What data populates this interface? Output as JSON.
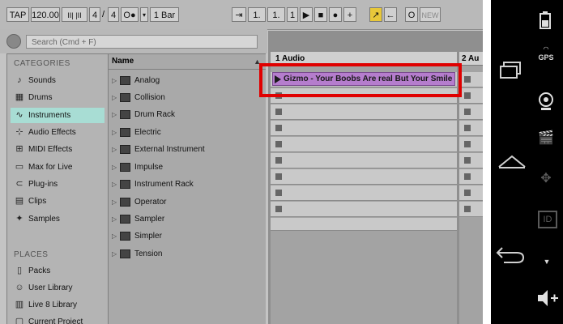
{
  "toolbar": {
    "tap": "TAP",
    "tempo": "120.00",
    "signature_num": "4",
    "signature_den": "4",
    "metro": "O●",
    "quantize": "1 Bar",
    "position_bar": "1.",
    "position_beat": "1.",
    "position_sixteenth": "1",
    "new_label": "NEW"
  },
  "search": {
    "placeholder": "Search (Cmd + F)"
  },
  "categories": {
    "title": "CATEGORIES",
    "items": [
      {
        "label": "Sounds",
        "icon": "note-icon"
      },
      {
        "label": "Drums",
        "icon": "drums-icon"
      },
      {
        "label": "Instruments",
        "icon": "wave-icon",
        "selected": true
      },
      {
        "label": "Audio Effects",
        "icon": "audio-effects-icon"
      },
      {
        "label": "MIDI Effects",
        "icon": "midi-effects-icon"
      },
      {
        "label": "Max for Live",
        "icon": "max-icon"
      },
      {
        "label": "Plug-ins",
        "icon": "plugin-icon"
      },
      {
        "label": "Clips",
        "icon": "clip-icon"
      },
      {
        "label": "Samples",
        "icon": "samples-icon"
      }
    ]
  },
  "places": {
    "title": "PLACES",
    "items": [
      {
        "label": "Packs"
      },
      {
        "label": "User Library"
      },
      {
        "label": "Live 8 Library"
      },
      {
        "label": "Current Project"
      }
    ]
  },
  "names": {
    "header": "Name",
    "items": [
      "Analog",
      "Collision",
      "Drum Rack",
      "Electric",
      "External Instrument",
      "Impulse",
      "Instrument Rack",
      "Operator",
      "Sampler",
      "Simpler",
      "Tension"
    ]
  },
  "tracks": {
    "track1": "1 Audio",
    "track2": "2 Au",
    "clip": "Gizmo - Your Boobs Are real But Your Smile Is Fake"
  },
  "statusbar": {
    "gps": "GPS",
    "id": "ID"
  },
  "colors": {
    "selected_category": "#a8ddd4",
    "clip": "#b57dcd",
    "highlight": "#e00000",
    "accent_yellow": "#e8c83a"
  }
}
